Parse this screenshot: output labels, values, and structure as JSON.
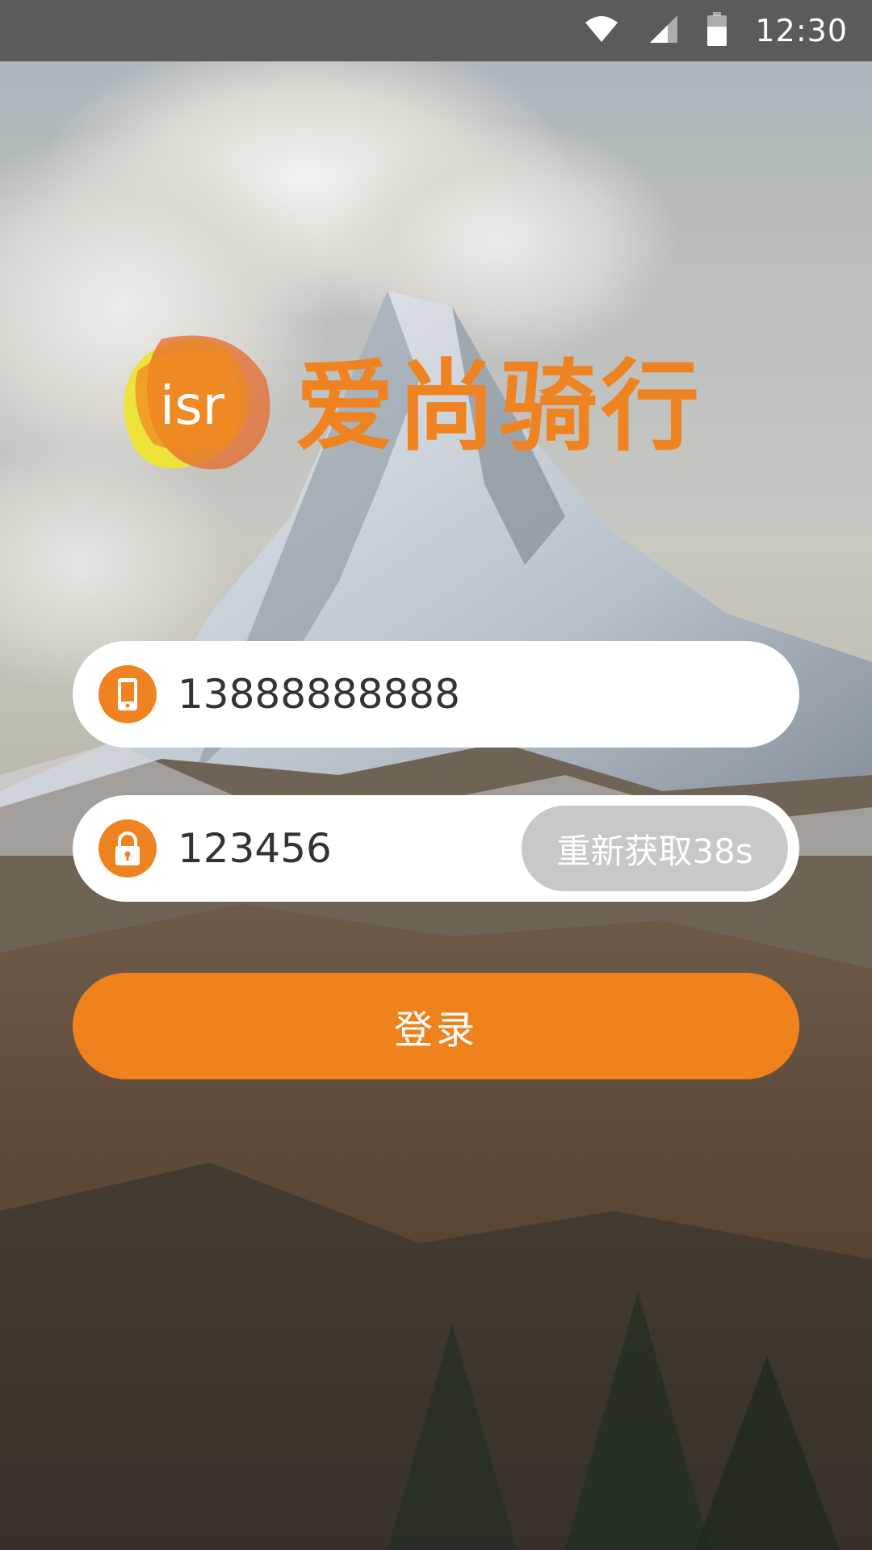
{
  "status_bar": {
    "time": "12:30",
    "icons": [
      "wifi-icon",
      "cell-signal-icon",
      "battery-icon"
    ]
  },
  "logo": {
    "mark_text": "isr",
    "app_name": "爱尚骑行"
  },
  "login_form": {
    "phone": {
      "icon": "phone-icon",
      "value": "13888888888"
    },
    "code": {
      "icon": "lock-icon",
      "value": "123456",
      "resend_label": "重新获取38s"
    },
    "login_label": "登录"
  },
  "colors": {
    "accent": "#f08321",
    "resend_disabled": "#c8c8c8",
    "status_bar": "#5b5b5b"
  }
}
